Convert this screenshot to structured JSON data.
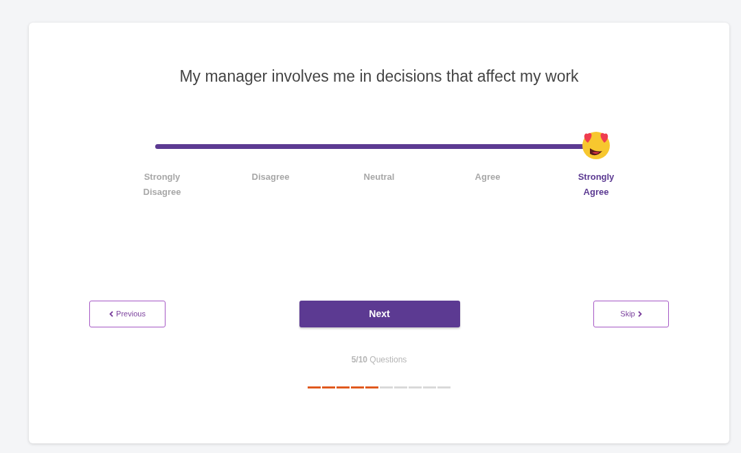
{
  "question": "My manager involves me in decisions that affect my work",
  "slider": {
    "level": 1
  },
  "options": [
    {
      "label": "Strongly Disagree",
      "selected": false
    },
    {
      "label": "Disagree",
      "selected": false
    },
    {
      "label": "Neutral",
      "selected": false
    },
    {
      "label": "Agree",
      "selected": false
    },
    {
      "label": "Strongly Agree",
      "selected": true
    }
  ],
  "buttons": {
    "previous": "Previous",
    "next": "Next",
    "skip": "Skip"
  },
  "progress_text": "**5/10** Questions",
  "progress": [
    {
      "done": true
    },
    {
      "done": true
    },
    {
      "done": true
    },
    {
      "done": true
    },
    {
      "done": true
    },
    {
      "done": false
    },
    {
      "done": false
    },
    {
      "done": false
    },
    {
      "done": false
    },
    {
      "done": false
    }
  ]
}
